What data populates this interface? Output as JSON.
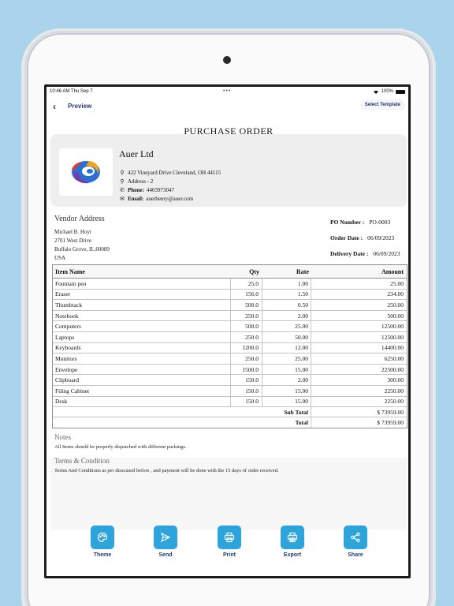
{
  "status_bar": {
    "time": "10:46 AM  Thu Sep 7",
    "dots": "•••",
    "battery": "100%"
  },
  "nav": {
    "back": "‹",
    "title": "Preview",
    "select_template": "Select Template"
  },
  "document": {
    "title": "PURCHASE ORDER",
    "company": {
      "name": "Auer Ltd",
      "address1": "422 Vineyard Drive Cleveland, OH 44115",
      "address2": "Address - 2",
      "phone_label": "Phone:",
      "phone": "4403973047",
      "email_label": "Email:",
      "email": "auerhenry@auer.com"
    },
    "vendor": {
      "heading": "Vendor Address",
      "lines": [
        "Michael B. Hoyt",
        "2701 West Drive",
        "Buffalo Grove, IL,60089",
        "USA"
      ]
    },
    "po": [
      {
        "label": "PO Number :",
        "value": "PO-0003"
      },
      {
        "label": "Order Date :",
        "value": "06/09/2023"
      },
      {
        "label": "Delivery Date :",
        "value": "06/09/2023"
      }
    ],
    "table": {
      "headers": [
        "Item Name",
        "Qty",
        "Rate",
        "Amount"
      ],
      "rows": [
        [
          "Fountain pen",
          "25.0",
          "1.00",
          "25.00"
        ],
        [
          "Eraser",
          "156.0",
          "1.50",
          "234.00"
        ],
        [
          "Thumbtack",
          "500.0",
          "0.50",
          "250.00"
        ],
        [
          "Notebook",
          "250.0",
          "2.00",
          "500.00"
        ],
        [
          "Computers",
          "500.0",
          "25.00",
          "12500.00"
        ],
        [
          "Laptops",
          "250.0",
          "50.00",
          "12500.00"
        ],
        [
          "Keyboards",
          "1200.0",
          "12.00",
          "14400.00"
        ],
        [
          "Monitors",
          "250.0",
          "25.00",
          "6250.00"
        ],
        [
          "Envelope",
          "1500.0",
          "15.00",
          "22500.00"
        ],
        [
          "Clipboard",
          "150.0",
          "2.00",
          "300.00"
        ],
        [
          "Filing Cabinet",
          "150.0",
          "15.00",
          "2250.00"
        ],
        [
          "Desk",
          "150.0",
          "15.00",
          "2250.00"
        ]
      ],
      "sub_total_label": "Sub Total",
      "sub_total": "$ 73959.00",
      "total_label": "Total",
      "total": "$ 73959.00"
    },
    "notes_heading": "Notes",
    "notes_text": "All Items should be properly dispatched with different packings.",
    "terms_heading": "Terms & Condition",
    "terms_text": "Terms And Conditions as per disscused before , and payment will be done with the 15 days of order received."
  },
  "actions": [
    {
      "label": "Theme",
      "icon": "palette-icon"
    },
    {
      "label": "Send",
      "icon": "send-icon"
    },
    {
      "label": "Print",
      "icon": "printer-icon"
    },
    {
      "label": "Export",
      "icon": "export-icon"
    },
    {
      "label": "Share",
      "icon": "share-icon"
    }
  ],
  "colors": {
    "accent": "#2da4dc",
    "nav_text": "#1f3a7a",
    "background": "#a9d4ec"
  }
}
